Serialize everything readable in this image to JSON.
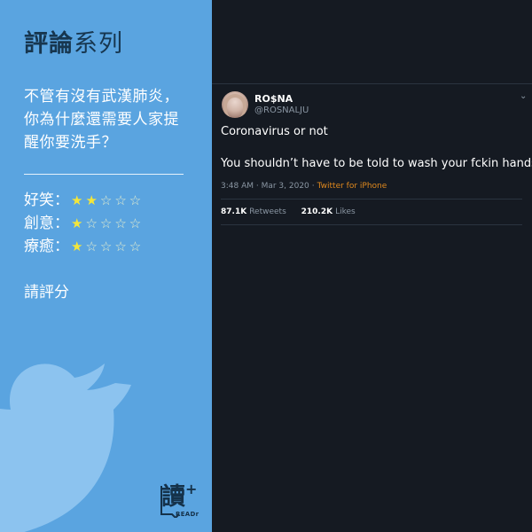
{
  "left_panel": {
    "series_title_bold": "評論",
    "series_title_light": "系列",
    "question_lines": [
      "不管有沒有武漢肺炎，",
      "你為什麼還需要人家提",
      "醒你要洗手？"
    ],
    "ratings": [
      {
        "label": "好笑：",
        "stars_full": "★★",
        "stars_empty": "☆☆☆",
        "score": 2,
        "max": 5
      },
      {
        "label": "創意：",
        "stars_full": "★",
        "stars_empty": "☆☆☆☆",
        "score": 1,
        "max": 5
      },
      {
        "label": "療癒：",
        "stars_full": "★",
        "stars_empty": "☆☆☆☆",
        "score": 1,
        "max": 5
      }
    ],
    "prompt": "請評分",
    "logo_char": "讀",
    "logo_plus": "+",
    "logo_sub": "READr",
    "colors": {
      "panel": "#5aa4e0",
      "title": "#17364f",
      "star": "#f4e63a"
    }
  },
  "tweet": {
    "name": "RO$NA",
    "handle": "@ROSNALJU",
    "chevron": "⌄",
    "text_line1": "Coronavirus or not",
    "text_line2": "You shouldn’t have to be told to wash your fckin hands",
    "time": "3:48 AM · Mar 3, 2020",
    "separator": "·",
    "source": "Twitter for iPhone",
    "retweets_count": "87.1K",
    "retweets_label": "Retweets",
    "likes_count": "210.2K",
    "likes_label": "Likes",
    "colors": {
      "background": "#151a22",
      "source": "#e0891d",
      "muted": "#8a96a3"
    }
  }
}
